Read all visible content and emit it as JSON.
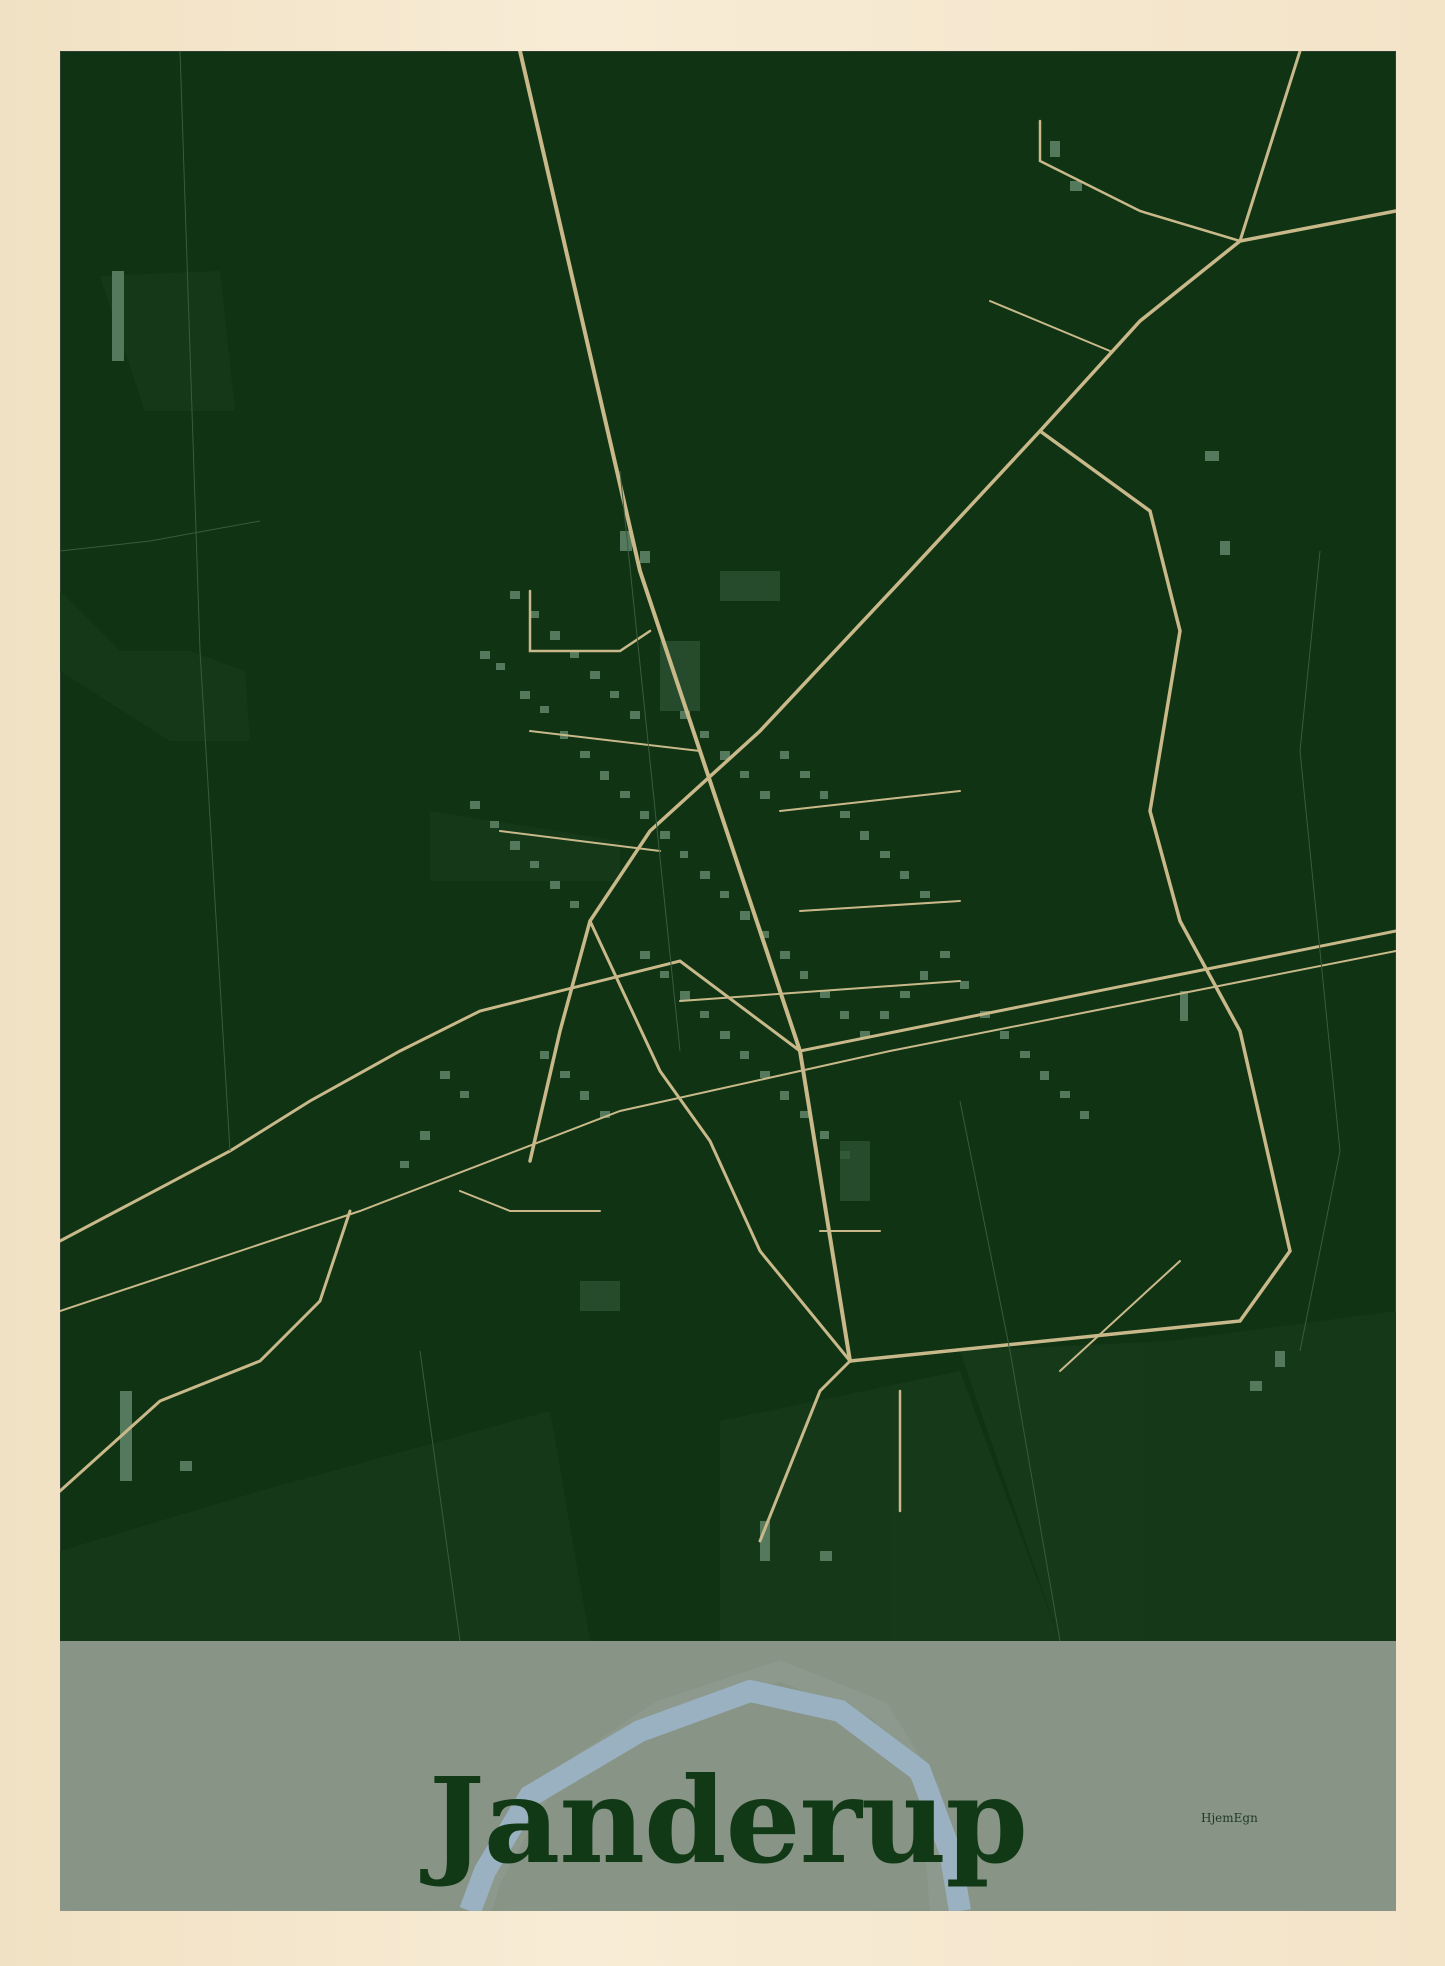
{
  "poster": {
    "title": "Janderup",
    "brand": "HjemEgn"
  },
  "colors": {
    "frame": "#f4e7cf",
    "land": "#0f3313",
    "roads": "#c9b98a",
    "buildings": "#55795c",
    "band": "#8b988a",
    "river": "#9ab1c2",
    "title_text": "#113915"
  },
  "icons": {
    "brand_logo": "hjemegn-logo"
  }
}
